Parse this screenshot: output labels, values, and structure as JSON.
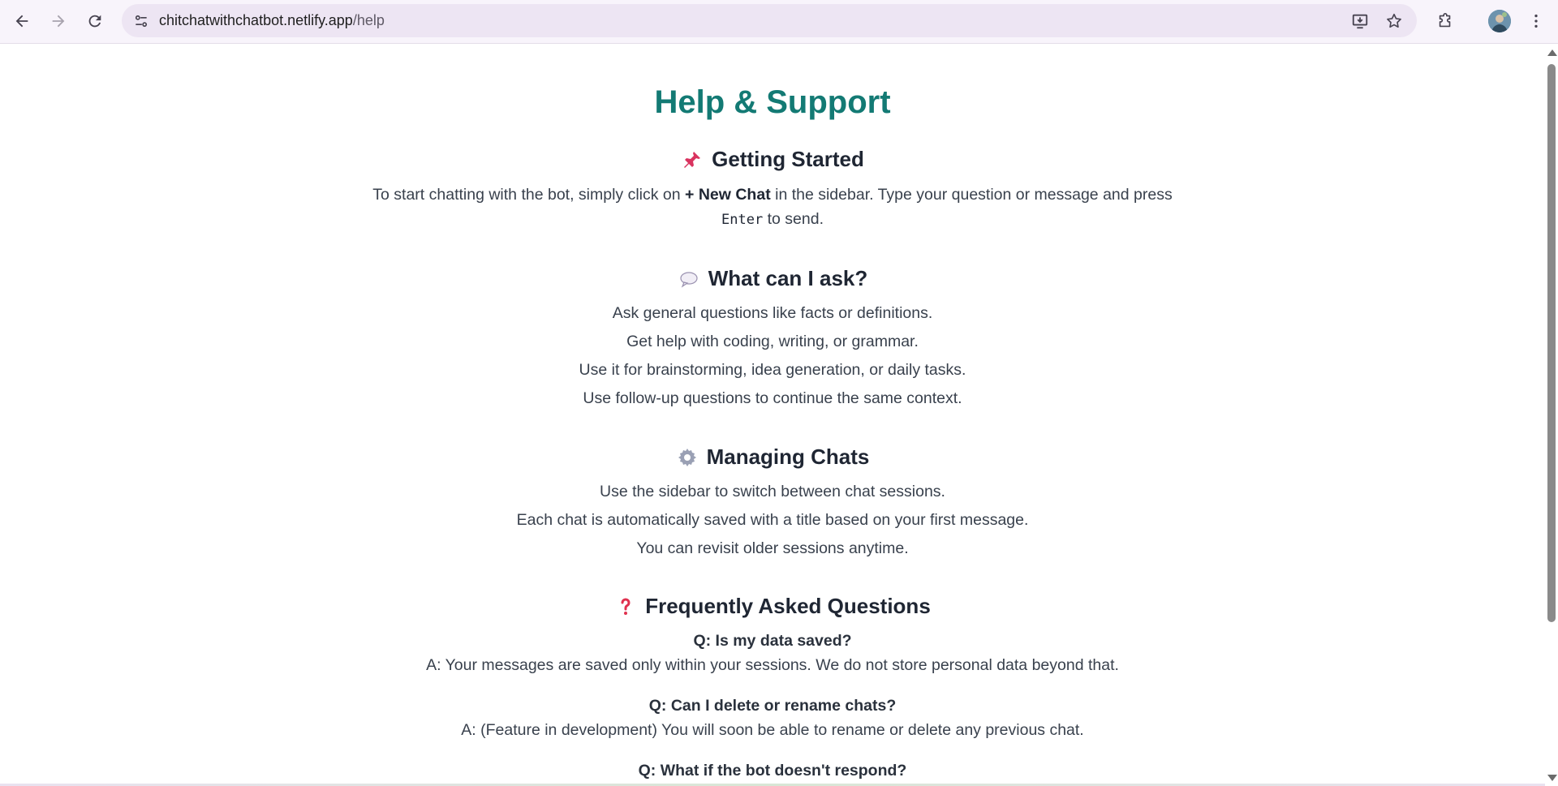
{
  "browser": {
    "url_host": "chitchatwithchatbot.netlify.app",
    "url_path": "/help"
  },
  "page": {
    "title": "Help & Support",
    "getting_started": {
      "heading": "Getting Started",
      "icon": "pushpin-icon",
      "text_before": "To start chatting with the bot, simply click on ",
      "bold": "+ New Chat",
      "text_middle": " in the sidebar. Type your question or message and press",
      "code": "Enter",
      "text_after": " to send."
    },
    "what_can_i_ask": {
      "heading": "What can I ask?",
      "icon": "speech-bubble-icon",
      "items": [
        "Ask general questions like facts or definitions.",
        "Get help with coding, writing, or grammar.",
        "Use it for brainstorming, idea generation, or daily tasks.",
        "Use follow-up questions to continue the same context."
      ]
    },
    "managing_chats": {
      "heading": "Managing Chats",
      "icon": "gear-icon",
      "items": [
        "Use the sidebar to switch between chat sessions.",
        "Each chat is automatically saved with a title based on your first message.",
        "You can revisit older sessions anytime."
      ]
    },
    "faq": {
      "heading": "Frequently Asked Questions",
      "icon": "question-mark-icon",
      "items": [
        {
          "q": "Q: Is my data saved?",
          "a": "A: Your messages are saved only within your sessions. We do not store personal data beyond that."
        },
        {
          "q": "Q: Can I delete or rename chats?",
          "a": "A: (Feature in development) You will soon be able to rename or delete any previous chat."
        },
        {
          "q": "Q: What if the bot doesn't respond?",
          "a": ""
        }
      ]
    }
  },
  "colors": {
    "title": "#137a74",
    "chrome_bg": "#f8f4fb",
    "omnibox_bg": "#ede5f3"
  }
}
